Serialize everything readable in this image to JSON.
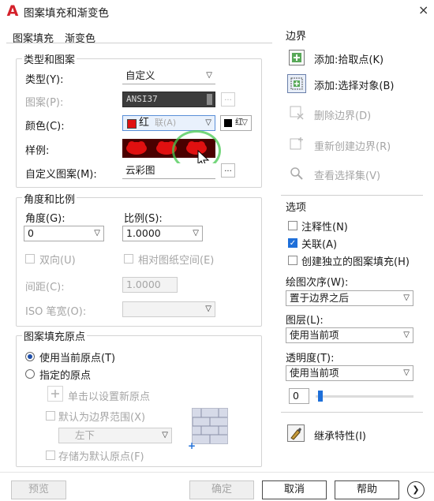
{
  "window": {
    "title": "图案填充和渐变色",
    "close_glyph": "×"
  },
  "tabs": [
    {
      "label": "图案填充",
      "active": true
    },
    {
      "label": "渐变色",
      "active": false
    }
  ],
  "type_pattern": {
    "group_title": "类型和图案",
    "type_label": "类型(Y):",
    "type_value": "自定义",
    "pattern_label": "图案(P):",
    "pattern_value": "ANSI37",
    "color_label": "颜色(C):",
    "color_value": "红",
    "color_ghost": "联(A)",
    "bg_color_value": "红",
    "swatch_label": "样例:",
    "custom_label": "自定义图案(M):",
    "custom_value": "云彩图",
    "browse_glyph": "..."
  },
  "angle_scale": {
    "group_title": "角度和比例",
    "angle_label": "角度(G):",
    "angle_value": "0",
    "scale_label": "比例(S):",
    "scale_value": "1.0000",
    "double_label": "双向(U)",
    "relative_label": "相对图纸空间(E)",
    "spacing_label": "间距(C):",
    "spacing_value": "1.0000",
    "iso_label": "ISO 笔宽(O):"
  },
  "origin": {
    "group_title": "图案填充原点",
    "use_current_label": "使用当前原点(T)",
    "specified_label": "指定的原点",
    "click_set_label": "单击以设置新原点",
    "default_extent_label": "默认为边界范围(X)",
    "position_value": "左下",
    "store_default_label": "存储为默认原点(F)"
  },
  "boundary": {
    "group_title": "边界",
    "add_pick_label": "添加:拾取点(K)",
    "add_select_label": "添加:选择对象(B)",
    "remove_label": "删除边界(D)",
    "recreate_label": "重新创建边界(R)",
    "view_label": "查看选择集(V)"
  },
  "options": {
    "group_title": "选项",
    "annotative_label": "注释性(N)",
    "annotative_checked": false,
    "associative_label": "关联(A)",
    "associative_checked": true,
    "separate_label": "创建独立的图案填充(H)",
    "separate_checked": false,
    "draw_order_label": "绘图次序(W):",
    "draw_order_value": "置于边界之后",
    "layer_label": "图层(L):",
    "layer_value": "使用当前项",
    "transparency_label": "透明度(T):",
    "transparency_value": "使用当前项",
    "transparency_number": "0"
  },
  "inherit_label": "继承特性(I)",
  "footer": {
    "preview_label": "预览",
    "ok_label": "确定",
    "cancel_label": "取消",
    "help_label": "帮助",
    "expand_glyph": "❯"
  },
  "colors": {
    "accent": "#1e6fd9",
    "hatch_red": "#e01010",
    "app_red": "#d4202a"
  }
}
